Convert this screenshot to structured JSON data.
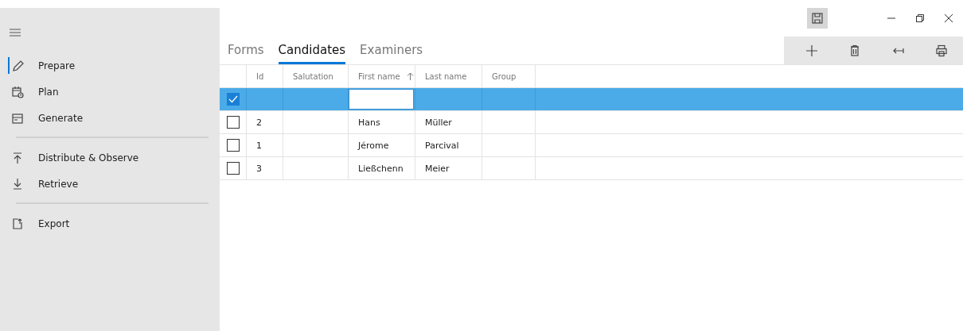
{
  "sidebar": {
    "groups": [
      {
        "items": [
          {
            "label": "Prepare",
            "kind": "pencil",
            "selected": true
          },
          {
            "label": "Plan",
            "kind": "calendar",
            "selected": false
          },
          {
            "label": "Generate",
            "kind": "tray",
            "selected": false
          }
        ]
      },
      {
        "items": [
          {
            "label": "Distribute & Observe",
            "kind": "upload",
            "selected": false
          },
          {
            "label": "Retrieve",
            "kind": "download",
            "selected": false
          }
        ]
      },
      {
        "items": [
          {
            "label": "Export",
            "kind": "export",
            "selected": false
          }
        ]
      }
    ]
  },
  "tabs": [
    {
      "label": "Forms",
      "selected": false
    },
    {
      "label": "Candidates",
      "selected": true
    },
    {
      "label": "Examiners",
      "selected": false
    }
  ],
  "toolbar": [
    {
      "kind": "add"
    },
    {
      "kind": "delete"
    },
    {
      "kind": "back"
    },
    {
      "kind": "print"
    }
  ],
  "table": {
    "columns": [
      {
        "label": "Id",
        "sorted": false
      },
      {
        "label": "Salutation",
        "sorted": false
      },
      {
        "label": "First name",
        "sorted": true
      },
      {
        "label": "Last name",
        "sorted": false
      },
      {
        "label": "Group",
        "sorted": false
      }
    ],
    "rows": [
      {
        "selected": true,
        "checked": true,
        "editing": true,
        "cells": [
          "",
          "",
          "",
          "",
          ""
        ]
      },
      {
        "selected": false,
        "checked": false,
        "editing": false,
        "cells": [
          "2",
          "",
          "Hans",
          "Müller",
          ""
        ]
      },
      {
        "selected": false,
        "checked": false,
        "editing": false,
        "cells": [
          "1",
          "",
          "Jérome",
          "Parcival",
          ""
        ]
      },
      {
        "selected": false,
        "checked": false,
        "editing": false,
        "cells": [
          "3",
          "",
          "Ließchenn",
          "Meier",
          ""
        ]
      }
    ]
  }
}
